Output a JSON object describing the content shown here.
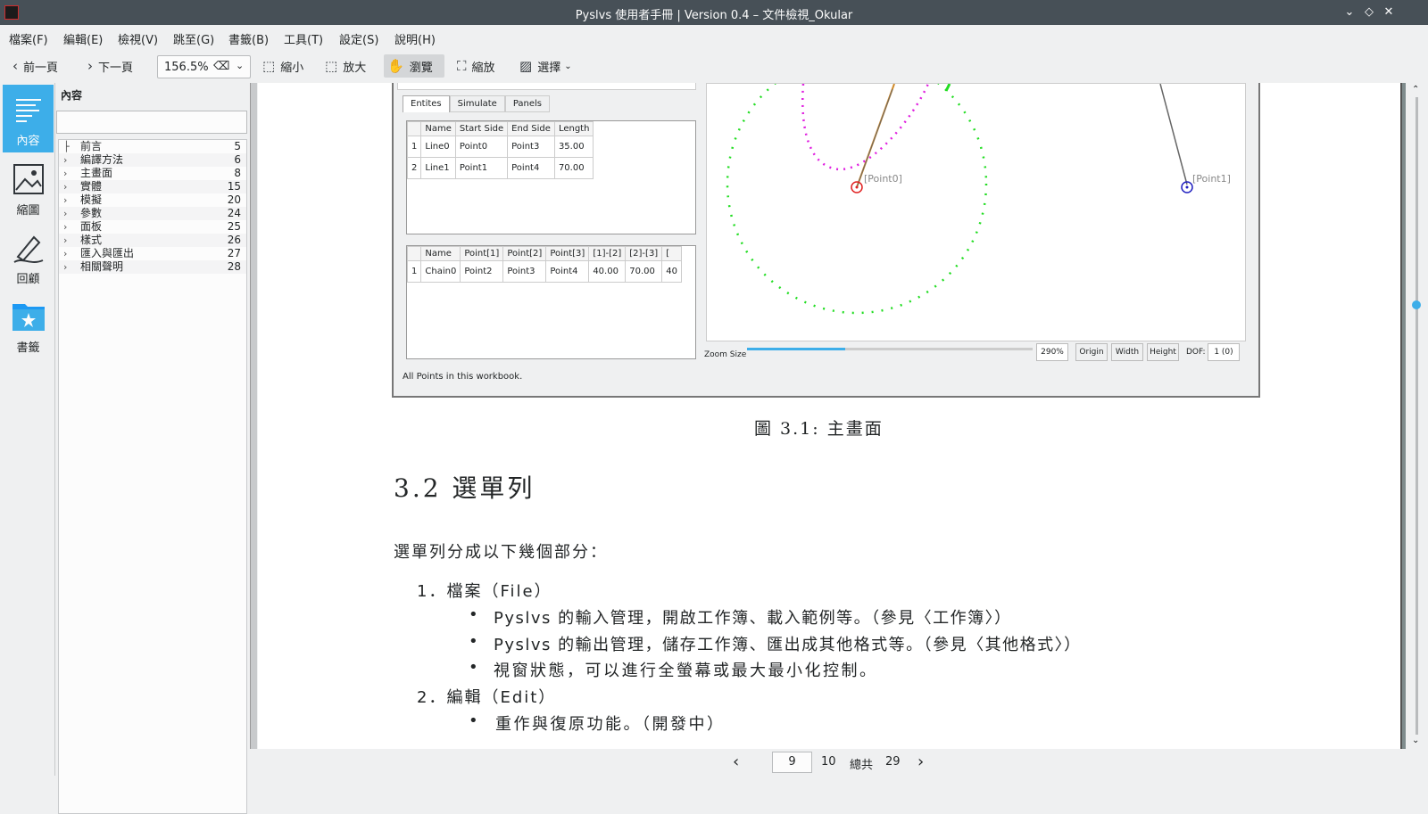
{
  "window": {
    "title": "Pyslvs 使用者手冊 | Version 0.4 – 文件檢視_Okular"
  },
  "menubar": [
    "檔案(F)",
    "編輯(E)",
    "檢視(V)",
    "跳至(G)",
    "書籤(B)",
    "工具(T)",
    "設定(S)",
    "說明(H)"
  ],
  "toolbar": {
    "prev": "前一頁",
    "next": "下一頁",
    "zoom_value": "156.5%",
    "zoom_out": "縮小",
    "zoom_in": "放大",
    "browse": "瀏覽",
    "zoom_tool": "縮放",
    "select": "選擇"
  },
  "sidebar_tabs": [
    "內容",
    "縮圖",
    "回顧",
    "書籤"
  ],
  "panel": {
    "title": "內容",
    "toc": [
      {
        "label": "前言",
        "page": "5"
      },
      {
        "label": "編譯方法",
        "page": "6"
      },
      {
        "label": "主畫面",
        "page": "8"
      },
      {
        "label": "實體",
        "page": "15"
      },
      {
        "label": "模擬",
        "page": "20"
      },
      {
        "label": "參數",
        "page": "24"
      },
      {
        "label": "面板",
        "page": "25"
      },
      {
        "label": "樣式",
        "page": "26"
      },
      {
        "label": "匯入與匯出",
        "page": "27"
      },
      {
        "label": "相關聲明",
        "page": "28"
      }
    ]
  },
  "screenshot": {
    "tabs": [
      "Entites",
      "Simulate",
      "Panels"
    ],
    "table1": {
      "headers": [
        "Name",
        "Start Side",
        "End Side",
        "Length"
      ],
      "rows": [
        [
          "1",
          "Line0",
          "Point0",
          "Point3",
          "35.00"
        ],
        [
          "2",
          "Line1",
          "Point1",
          "Point4",
          "70.00"
        ]
      ]
    },
    "table2": {
      "headers": [
        "Name",
        "Point[1]",
        "Point[2]",
        "Point[3]",
        "[1]-[2]",
        "[2]-[3]",
        "["
      ],
      "rows": [
        [
          "1",
          "Chain0",
          "Point2",
          "Point3",
          "Point4",
          "40.00",
          "70.00",
          "40"
        ]
      ]
    },
    "status": "All Points in this workbook.",
    "point0": "[Point0]",
    "point1": "[Point1]",
    "zoom_label": "Zoom Size",
    "zoom_pct": "290%",
    "buttons": [
      "Origin",
      "Width",
      "Height"
    ],
    "dof_label": "DOF:",
    "dof_value": "1 (0)"
  },
  "document": {
    "caption": "圖 3.1:  主畫面",
    "section": "3.2   選單列",
    "intro": "選單列分成以下幾個部分：",
    "item1": "1．檔案（File）",
    "item1_b1": "Pyslvs 的輸入管理，開啟工作簿、載入範例等。（參見〈工作簿〉）",
    "item1_b2": "Pyslvs 的輸出管理，儲存工作簿、匯出成其他格式等。（參見〈其他格式〉）",
    "item1_b3": "視窗狀態，可以進行全螢幕或最大最小化控制。",
    "item2": "2．編輯（Edit）",
    "item2_b1": "重作與復原功能。（開發中）"
  },
  "pager": {
    "current": "9",
    "next": "10",
    "total_label": "總共",
    "total": "29"
  },
  "colors": {
    "accent": "#3daee9",
    "titlebar": "#475057"
  }
}
